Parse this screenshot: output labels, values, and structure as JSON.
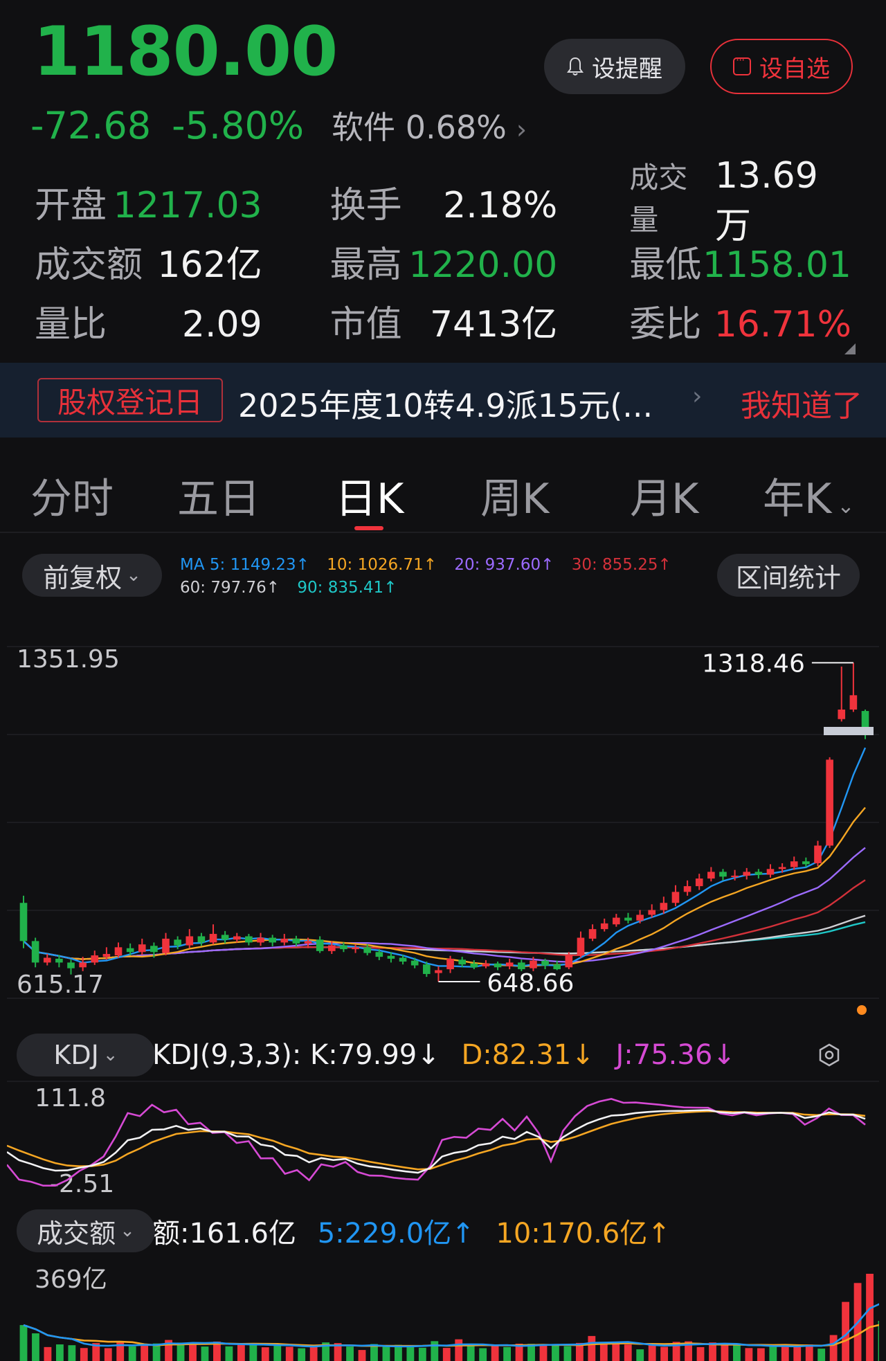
{
  "quote": {
    "price": "1180.00",
    "change": "-72.68",
    "change_pct": "-5.80%",
    "sector_name": "软件",
    "sector_pct": "0.68%",
    "remind_label": "设提醒",
    "add_label": "设自选",
    "colors": {
      "down": "#21b24b",
      "up": "#f0333c",
      "bg": "#101012"
    }
  },
  "stats": [
    [
      {
        "label": "开盘",
        "value": "1217.03",
        "tone": "green"
      },
      {
        "label": "换手",
        "value": "2.18%",
        "tone": "white"
      },
      {
        "label": "成交量",
        "value": "13.69万",
        "tone": "white"
      }
    ],
    [
      {
        "label": "成交额",
        "value": "162亿",
        "tone": "white"
      },
      {
        "label": "最高",
        "value": "1220.00",
        "tone": "green"
      },
      {
        "label": "最低",
        "value": "1158.01",
        "tone": "green"
      }
    ],
    [
      {
        "label": "量比",
        "value": "2.09",
        "tone": "white"
      },
      {
        "label": "市值",
        "value": "7413亿",
        "tone": "white"
      },
      {
        "label": "委比",
        "value": "16.71%",
        "tone": "red"
      }
    ]
  ],
  "banner": {
    "tag": "股权登记日",
    "text": "2025年度10转4.9派15元(...",
    "action": "我知道了"
  },
  "tabs": [
    "分时",
    "五日",
    "日K",
    "周K",
    "月K",
    "年K"
  ],
  "active_tab": 2,
  "chart_controls": {
    "adjust": "前复权",
    "range_stats": "区间统计",
    "ma_legend": [
      {
        "text": "MA 5: 1149.23↑",
        "color": "#2196f3"
      },
      {
        "text": "10: 1026.71↑",
        "color": "#f5a623"
      },
      {
        "text": "20: 937.60↑",
        "color": "#9c6bff"
      },
      {
        "text": "30: 855.25↑",
        "color": "#d3313a"
      },
      {
        "text": "60: 797.76↑",
        "color": "#cfcfd4"
      },
      {
        "text": "90: 835.41↑",
        "color": "#1fc7c7"
      }
    ]
  },
  "chart_data": {
    "type": "candlestick",
    "y_top_label": "1351.95",
    "y_bottom_label": "615.17",
    "ylim": [
      615.17,
      1351.95
    ],
    "high_marker": "1318.46",
    "low_marker": "648.66",
    "candles": [
      [
        815,
        735,
        830,
        720
      ],
      [
        735,
        690,
        742,
        680
      ],
      [
        690,
        700,
        708,
        684
      ],
      [
        698,
        690,
        706,
        680
      ],
      [
        690,
        678,
        696,
        665
      ],
      [
        680,
        690,
        702,
        672
      ],
      [
        690,
        705,
        715,
        685
      ],
      [
        702,
        708,
        722,
        696
      ],
      [
        705,
        722,
        732,
        700
      ],
      [
        720,
        712,
        730,
        705
      ],
      [
        712,
        728,
        740,
        706
      ],
      [
        725,
        712,
        732,
        700
      ],
      [
        710,
        740,
        752,
        705
      ],
      [
        738,
        726,
        745,
        718
      ],
      [
        726,
        745,
        760,
        720
      ],
      [
        745,
        732,
        752,
        725
      ],
      [
        732,
        750,
        770,
        728
      ],
      [
        748,
        738,
        756,
        730
      ],
      [
        738,
        745,
        752,
        732
      ],
      [
        745,
        732,
        750,
        726
      ],
      [
        732,
        742,
        752,
        725
      ],
      [
        742,
        732,
        748,
        724
      ],
      [
        732,
        740,
        750,
        726
      ],
      [
        740,
        730,
        746,
        724
      ],
      [
        730,
        735,
        742,
        720
      ],
      [
        738,
        714,
        745,
        710
      ],
      [
        714,
        726,
        735,
        708
      ],
      [
        726,
        718,
        732,
        712
      ],
      [
        718,
        722,
        728,
        710
      ],
      [
        722,
        710,
        728,
        705
      ],
      [
        712,
        702,
        718,
        695
      ],
      [
        704,
        698,
        712,
        690
      ],
      [
        700,
        692,
        706,
        686
      ],
      [
        694,
        684,
        700,
        678
      ],
      [
        686,
        666,
        692,
        660
      ],
      [
        668,
        674,
        682,
        650
      ],
      [
        676,
        698,
        704,
        668
      ],
      [
        696,
        686,
        702,
        680
      ],
      [
        688,
        680,
        695,
        676
      ],
      [
        682,
        688,
        695,
        678
      ],
      [
        688,
        680,
        692,
        674
      ],
      [
        682,
        690,
        698,
        676
      ],
      [
        690,
        676,
        696,
        672
      ],
      [
        678,
        694,
        702,
        672
      ],
      [
        694,
        684,
        698,
        676
      ],
      [
        686,
        676,
        694,
        674
      ],
      [
        680,
        706,
        712,
        676
      ],
      [
        705,
        742,
        755,
        700
      ],
      [
        740,
        760,
        770,
        735
      ],
      [
        760,
        772,
        782,
        755
      ],
      [
        770,
        784,
        792,
        765
      ],
      [
        784,
        778,
        794,
        772
      ],
      [
        778,
        790,
        800,
        772
      ],
      [
        790,
        800,
        812,
        784
      ],
      [
        800,
        815,
        828,
        792
      ],
      [
        815,
        838,
        852,
        808
      ],
      [
        838,
        850,
        862,
        830
      ],
      [
        850,
        866,
        876,
        842
      ],
      [
        866,
        880,
        890,
        860
      ],
      [
        880,
        870,
        886,
        862
      ],
      [
        870,
        872,
        884,
        862
      ],
      [
        872,
        880,
        888,
        864
      ],
      [
        880,
        874,
        886,
        866
      ],
      [
        874,
        886,
        896,
        868
      ],
      [
        886,
        890,
        898,
        878
      ],
      [
        890,
        902,
        912,
        884
      ],
      [
        902,
        896,
        910,
        890
      ],
      [
        898,
        935,
        945,
        892
      ],
      [
        935,
        1115,
        1120,
        930
      ],
      [
        1200,
        1220,
        1310,
        1195
      ],
      [
        1220,
        1250,
        1318,
        1215
      ],
      [
        1217,
        1180,
        1220,
        1158
      ]
    ]
  },
  "kdj_panel": {
    "selector": "KDJ",
    "label": "KDJ(9,3,3):",
    "k": "K:79.99↓",
    "d": "D:82.31↓",
    "j": "J:75.36↓",
    "y_top": "111.8",
    "y_bottom": "-2.51"
  },
  "vol_panel": {
    "selector": "成交额",
    "amount": "额:161.6亿",
    "ma5": "5:229.0亿↑",
    "ma10": "10:170.6亿↑",
    "y_top": "369亿",
    "y_bottom": "0"
  }
}
